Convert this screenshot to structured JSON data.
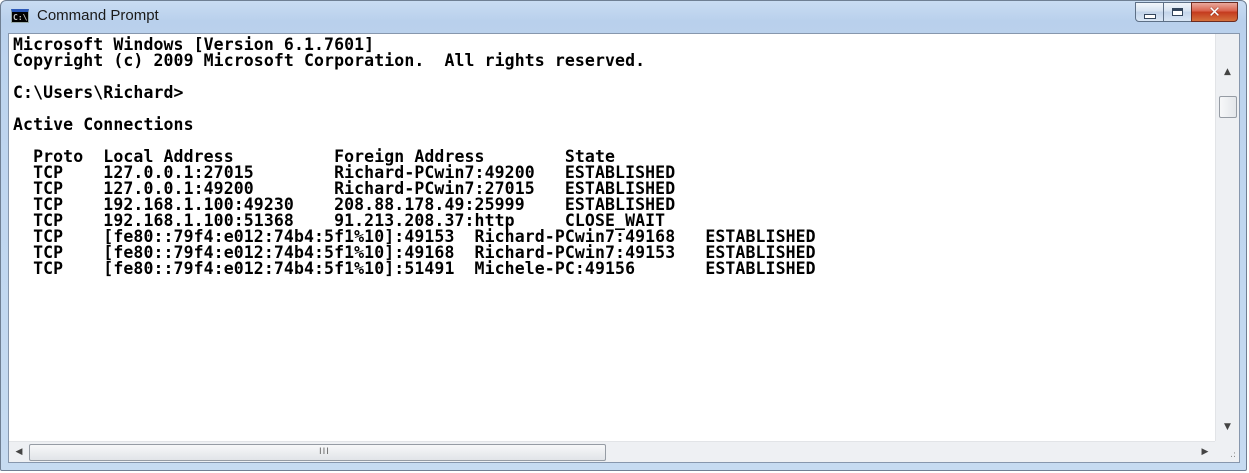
{
  "window": {
    "title": "Command Prompt",
    "icon_label": "C:\\",
    "icons": {
      "app": "cmd-console-icon",
      "minimize": "minimize-icon",
      "maximize": "maximize-icon",
      "close": "close-icon"
    },
    "close_glyph": "✕"
  },
  "console": {
    "lines": [
      "Microsoft Windows [Version 6.1.7601]",
      "Copyright (c) 2009 Microsoft Corporation.  All rights reserved.",
      "",
      "C:\\Users\\Richard>",
      "",
      "Active Connections",
      "",
      "  Proto  Local Address          Foreign Address        State",
      "  TCP    127.0.0.1:27015        Richard-PCwin7:49200   ESTABLISHED",
      "  TCP    127.0.0.1:49200        Richard-PCwin7:27015   ESTABLISHED",
      "  TCP    192.168.1.100:49230    208.88.178.49:25999    ESTABLISHED",
      "  TCP    192.168.1.100:51368    91.213.208.37:http     CLOSE_WAIT",
      "  TCP    [fe80::79f4:e012:74b4:5f1%10]:49153  Richard-PCwin7:49168   ESTABLISHED",
      "  TCP    [fe80::79f4:e012:74b4:5f1%10]:49168  Richard-PCwin7:49153   ESTABLISHED",
      "  TCP    [fe80::79f4:e012:74b4:5f1%10]:51491  Michele-PC:49156       ESTABLISHED"
    ]
  },
  "scrollbars": {
    "up_arrow": "▲",
    "down_arrow": "▼",
    "left_arrow": "◀",
    "right_arrow": "▶",
    "h_grip": "III",
    "size_grip": ".:"
  }
}
